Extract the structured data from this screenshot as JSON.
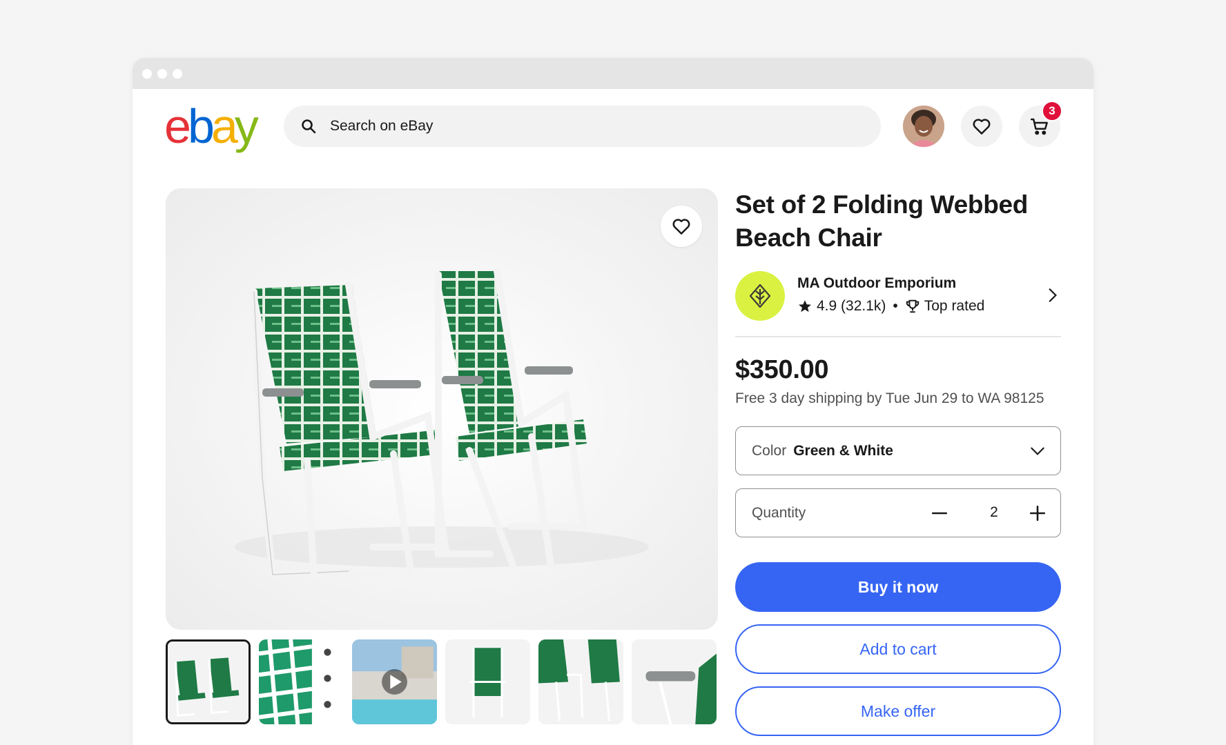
{
  "window": {
    "controls": [
      "dot",
      "dot",
      "dot"
    ]
  },
  "header": {
    "logo": {
      "letters": [
        "e",
        "b",
        "a",
        "y"
      ],
      "colors": [
        "#e53238",
        "#0064d2",
        "#f5af02",
        "#86b817"
      ]
    },
    "search": {
      "placeholder": "Search on eBay",
      "icon": "search-icon"
    },
    "avatar": "user-avatar",
    "watchlist_icon": "heart-icon",
    "cart": {
      "icon": "cart-icon",
      "badge": "3"
    }
  },
  "gallery": {
    "favorite_icon": "heart-icon",
    "thumbnails": [
      {
        "name": "thumbnail-two-chairs",
        "selected": true
      },
      {
        "name": "thumbnail-webbing-features",
        "selected": false
      },
      {
        "name": "thumbnail-video",
        "selected": false,
        "icon": "play-icon"
      },
      {
        "name": "thumbnail-folded-chair",
        "selected": false
      },
      {
        "name": "thumbnail-side-view",
        "selected": false
      },
      {
        "name": "thumbnail-armrest-detail",
        "selected": false
      }
    ]
  },
  "product": {
    "title": "Set of 2 Folding Webbed Beach Chair",
    "seller": {
      "name": "MA Outdoor Emporium",
      "rating": "4.9 (32.1k)",
      "separator": "•",
      "badge": "Top rated"
    },
    "price": "$350.00",
    "shipping": "Free 3 day shipping by Tue Jun 29 to WA 98125",
    "color": {
      "label": "Color",
      "value": "Green & White"
    },
    "quantity": {
      "label": "Quantity",
      "value": "2"
    },
    "buttons": {
      "buy": "Buy it now",
      "cart": "Add to cart",
      "offer": "Make offer"
    }
  },
  "colors": {
    "accent": "#3665f3",
    "badge": "#e0103a",
    "seller_logo_bg": "#dbf141",
    "chair_green": "#1f7a45"
  }
}
